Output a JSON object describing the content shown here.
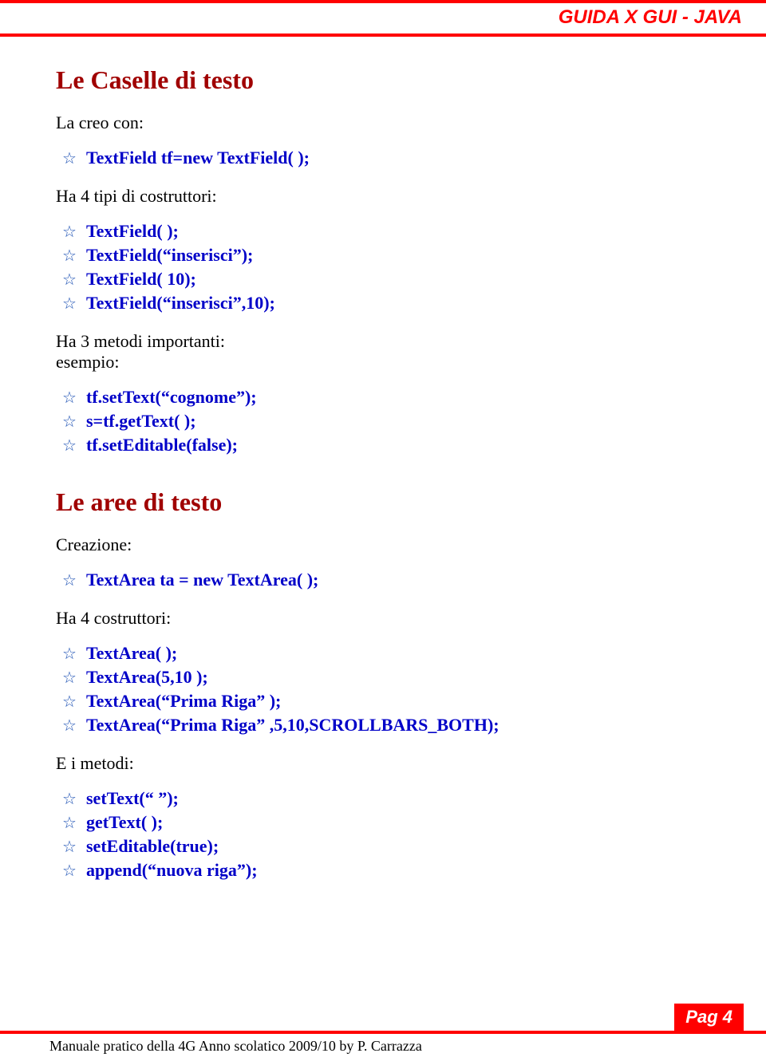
{
  "header": {
    "title": "GUIDA X GUI - JAVA"
  },
  "section1": {
    "heading": "Le Caselle di testo",
    "intro": "La creo con:",
    "creation_code": "TextField tf=new TextField( );",
    "constructors_label": "Ha 4 tipi di costruttori:",
    "constructors": [
      "TextField(  );",
      "TextField(“inserisci”);",
      "TextField( 10);",
      "TextField(“inserisci”,10);"
    ],
    "methods_label": "Ha 3 metodi importanti:",
    "methods_sublabel": "esempio:",
    "methods": [
      "tf.setText(“cognome”);",
      "s=tf.getText( );",
      "tf.setEditable(false);"
    ]
  },
  "section2": {
    "heading": "Le aree di testo",
    "intro": "Creazione:",
    "creation_code": "TextArea ta = new TextArea( );",
    "constructors_label": "Ha 4 costruttori:",
    "constructors": [
      "TextArea( );",
      "TextArea(5,10 );",
      "TextArea(“Prima Riga” );",
      "TextArea(“Prima Riga” ,5,10,SCROLLBARS_BOTH);"
    ],
    "methods_label": "E i metodi:",
    "methods": [
      "setText(“ ”);",
      "getText( );",
      "setEditable(true);",
      "append(“nuova riga”);"
    ]
  },
  "footer": {
    "page_label": "Pag 4",
    "text": "Manuale pratico della 4G Anno scolatico 2009/10 by P. Carrazza"
  }
}
